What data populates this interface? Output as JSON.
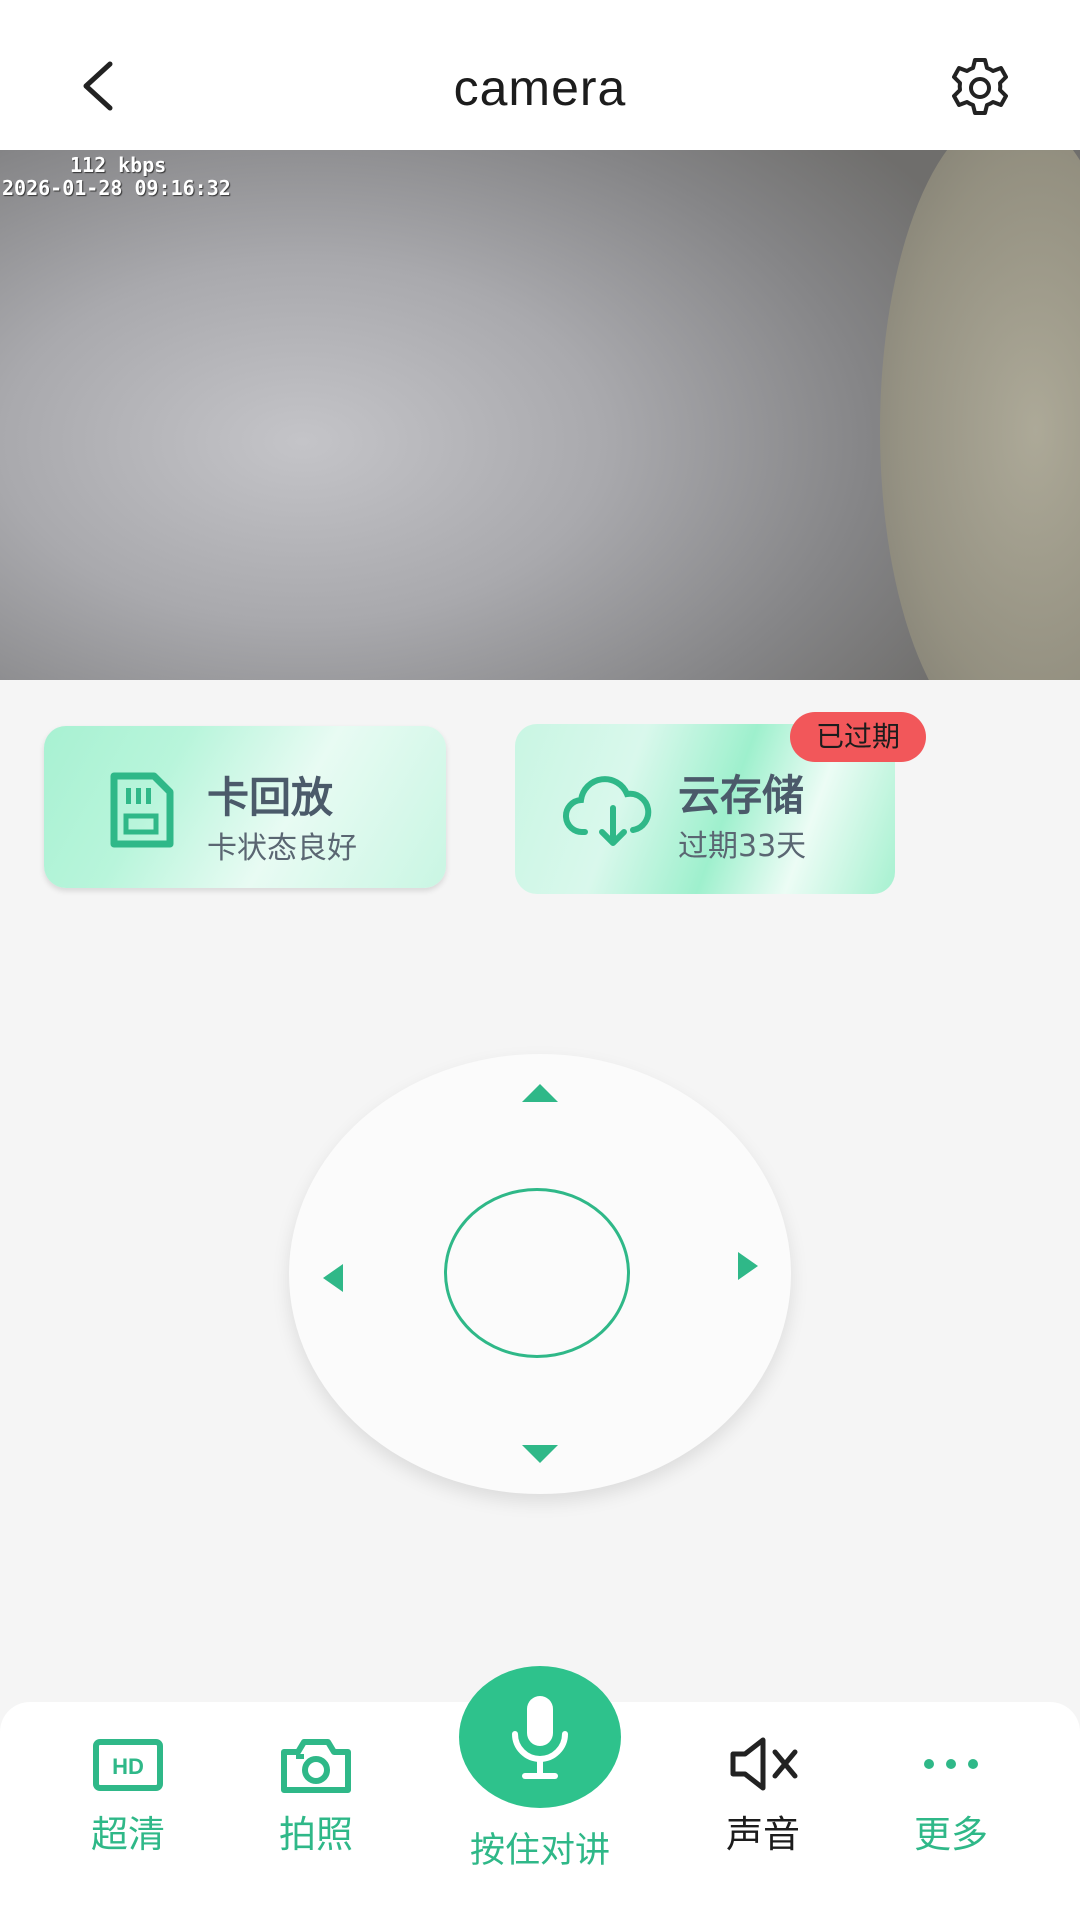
{
  "header": {
    "title": "camera"
  },
  "video": {
    "bitrate": "112 kbps",
    "timestamp": "2026-01-28 09:16:32"
  },
  "cards": {
    "playback": {
      "title": "卡回放",
      "subtitle": "卡状态良好",
      "icon": "sd-card-icon"
    },
    "cloud": {
      "title": "云存储",
      "subtitle": "过期33天",
      "badge": "已过期",
      "icon": "cloud-download-icon"
    }
  },
  "ptz": {
    "directions": [
      "up",
      "down",
      "left",
      "right"
    ]
  },
  "toolbar": {
    "hd_label": "超清",
    "snapshot_label": "拍照",
    "talk_label": "按住对讲",
    "sound_label": "声音",
    "more_label": "更多"
  },
  "colors": {
    "accent": "#2fb888",
    "badge": "#f2575a",
    "card_tint": "#a8f1d2"
  }
}
